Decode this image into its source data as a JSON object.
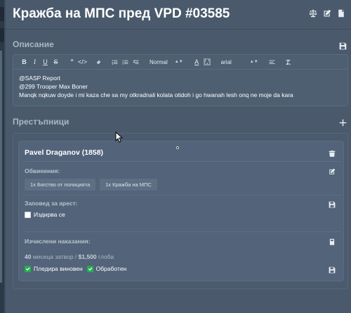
{
  "header": {
    "title": "Кражба на МПС пред VPD #03585",
    "icons": [
      "scale-icon",
      "edit-icon",
      "document-icon"
    ]
  },
  "description": {
    "section_title": "Описание",
    "toolbar": {
      "heading_select": "Normal",
      "font_select": "arial"
    },
    "lines": [
      "@SASP Report",
      "@299 Trooper Max Boner",
      "Manqk nqkuw doyde i mi kaza che sa my otkradnali kolata otidoh i go hwanah lesh onq ne moje da kara"
    ]
  },
  "offenders": {
    "section_title": "Престъпници",
    "items": [
      {
        "name": "Pavel Draganov (1858)",
        "charges_label": "Обвинения:",
        "charges": [
          "1x Бягство от полицията",
          "1x Кражба на МПС"
        ],
        "warrant_label": "Заповед за арест:",
        "warrant_checkbox_label": "Издирва се",
        "calculated_label": "Изчислени наказания:",
        "sentence_months": "40",
        "sentence_text": "месеца затвор /",
        "fine_amount": "$1,500",
        "fine_text": "глоба",
        "pleaded_guilty_label": "Пледира виновен",
        "processed_label": "Обработен"
      }
    ]
  },
  "colors": {
    "background": "#3d4d5e",
    "panel": "#4a5a6c",
    "checkbox_checked": "#22b14c"
  }
}
